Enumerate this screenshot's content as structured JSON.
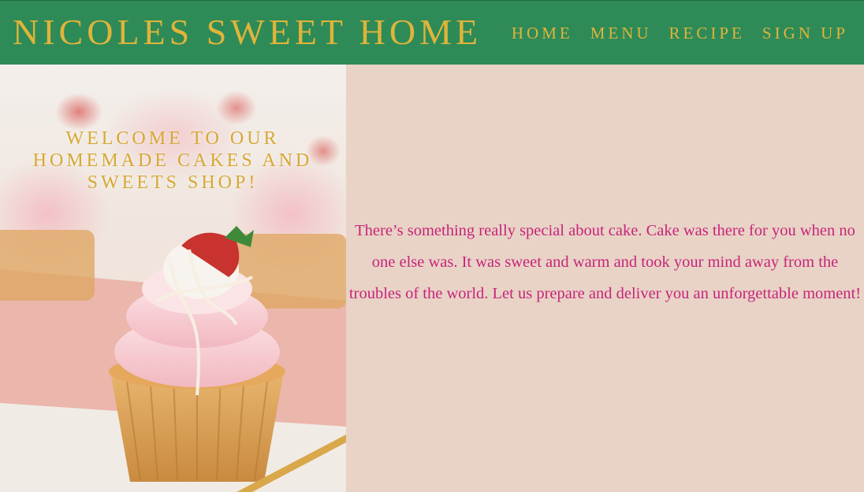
{
  "site": {
    "brand": "NICOLES SWEET HOME"
  },
  "nav": {
    "items": [
      {
        "label": "HOME"
      },
      {
        "label": "MENU"
      },
      {
        "label": "RECIPE"
      },
      {
        "label": "SIGN UP"
      }
    ]
  },
  "hero": {
    "title": "WELCOME TO OUR HOMEMADE CAKES AND SWEETS SHOP!"
  },
  "intro": {
    "text": "There’s something really special about cake. Cake was there for you when no one else was. It was sweet and warm and took your mind away from the troubles of the world. Let us prepare and deliver you an unforgettable moment!"
  },
  "colors": {
    "header_bg": "#2e8b57",
    "accent_gold": "#e0b43a",
    "page_bg": "#e8d3c6",
    "text_magenta": "#c8247a"
  }
}
